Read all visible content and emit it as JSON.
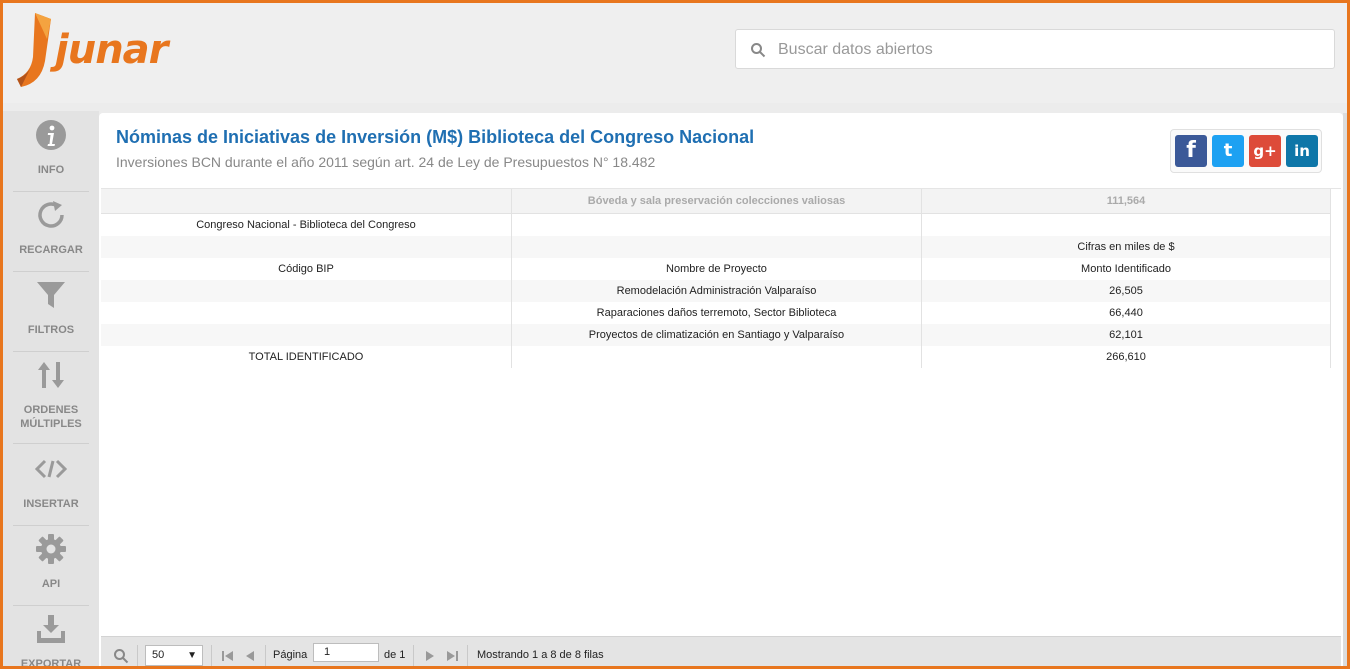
{
  "brand": {
    "name": "junar",
    "color": "#e8761e"
  },
  "search": {
    "placeholder": "Buscar datos abiertos",
    "value": ""
  },
  "sidebar": {
    "items": [
      {
        "id": "info",
        "label": "INFO",
        "icon": "info-icon"
      },
      {
        "id": "recargar",
        "label": "RECARGAR",
        "icon": "refresh-icon"
      },
      {
        "id": "filtros",
        "label": "FILTROS",
        "icon": "filter-icon"
      },
      {
        "id": "ordenes",
        "label": "ORDENES MÚLTIPLES",
        "icon": "sort-icon"
      },
      {
        "id": "insertar",
        "label": "INSERTAR",
        "icon": "embed-icon"
      },
      {
        "id": "api",
        "label": "API",
        "icon": "gear-icon"
      },
      {
        "id": "exportar",
        "label": "EXPORTAR",
        "icon": "download-icon"
      }
    ]
  },
  "dataset": {
    "title": "Nóminas de Iniciativas de Inversión (M$) Biblioteca del Congreso Nacional",
    "subtitle": "Inversiones BCN durante el año 2011 según art. 24 de Ley de Presupuestos N° 18.482"
  },
  "social": {
    "facebook": {
      "label": "f",
      "color": "#3b5998"
    },
    "twitter": {
      "label": "t",
      "color": "#1da1f2"
    },
    "googleplus": {
      "label": "g+",
      "color": "#dd4b39"
    },
    "linkedin": {
      "label": "in",
      "color": "#0e76a8"
    }
  },
  "table": {
    "header": [
      "",
      "Bóveda y sala preservación colecciones valiosas",
      "111,564"
    ],
    "rows": [
      [
        "Congreso Nacional - Biblioteca del Congreso",
        "",
        ""
      ],
      [
        "",
        "",
        "Cifras en miles de $"
      ],
      [
        "Código BIP",
        "Nombre de Proyecto",
        "Monto Identificado"
      ],
      [
        "",
        "Remodelación Administración Valparaíso",
        "26,505"
      ],
      [
        "",
        "Raparaciones daños terremoto, Sector Biblioteca",
        "66,440"
      ],
      [
        "",
        "Proyectos de climatización en Santiago y Valparaíso",
        "62,101"
      ],
      [
        "TOTAL IDENTIFICADO",
        "",
        "266,610"
      ]
    ]
  },
  "pagination": {
    "page_size": "50",
    "page_label": "Página",
    "page_value": "1",
    "of_label": "de 1",
    "status": "Mostrando 1 a 8 de 8 filas"
  }
}
